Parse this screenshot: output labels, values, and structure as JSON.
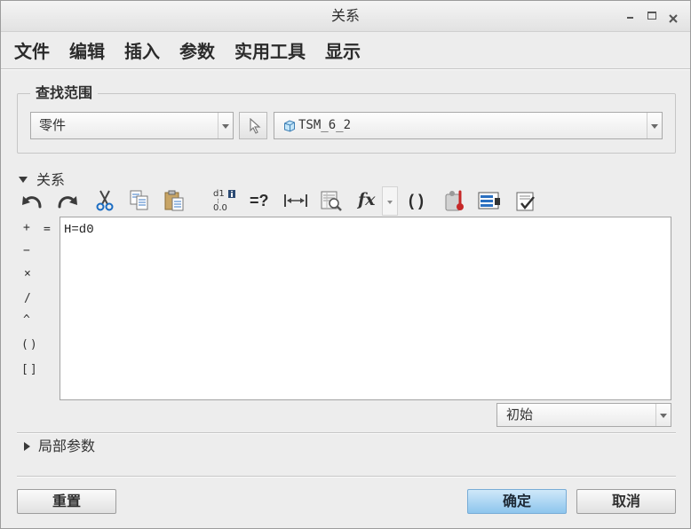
{
  "window": {
    "title": "关系"
  },
  "menu": {
    "items": [
      "文件",
      "编辑",
      "插入",
      "参数",
      "实用工具",
      "显示"
    ]
  },
  "find_scope": {
    "legend": "查找范围",
    "type_select": {
      "value": "零件"
    },
    "model_select": {
      "value": "TSM_6_2",
      "icon": "part-cube-icon"
    },
    "pick_button_icon": "pointer-icon"
  },
  "relations": {
    "label": "关系",
    "expanded": true,
    "editor_text": "H=d0",
    "operators": [
      "+",
      "=",
      "−",
      "×",
      "/",
      "^",
      "()",
      "[]"
    ],
    "toolbar": {
      "icons": [
        "undo-icon",
        "redo-icon",
        "cut-icon",
        "copy-icon",
        "paste-icon",
        "switch-dimensions-icon",
        "evaluate-icon",
        "measure-icon",
        "sort-relations-icon",
        "insert-function-icon",
        "insert-parentheses-icon",
        "verify-icon",
        "insert-from-list-icon",
        "check-relations-icon"
      ],
      "switch_dims_top": "d1",
      "switch_dims_bottom": "0.0",
      "evaluate_label": "=?",
      "function_label": "fx",
      "parentheses_label": "( )"
    },
    "state_select": {
      "value": "初始"
    }
  },
  "local_parameters": {
    "label": "局部参数",
    "expanded": false
  },
  "buttons": {
    "reset": "重置",
    "ok": "确定",
    "cancel": "取消"
  },
  "colors": {
    "window_bg": "#ededed",
    "editor_bg": "#ffffff",
    "ok_button": "#8dc5ed",
    "text": "#303030"
  }
}
